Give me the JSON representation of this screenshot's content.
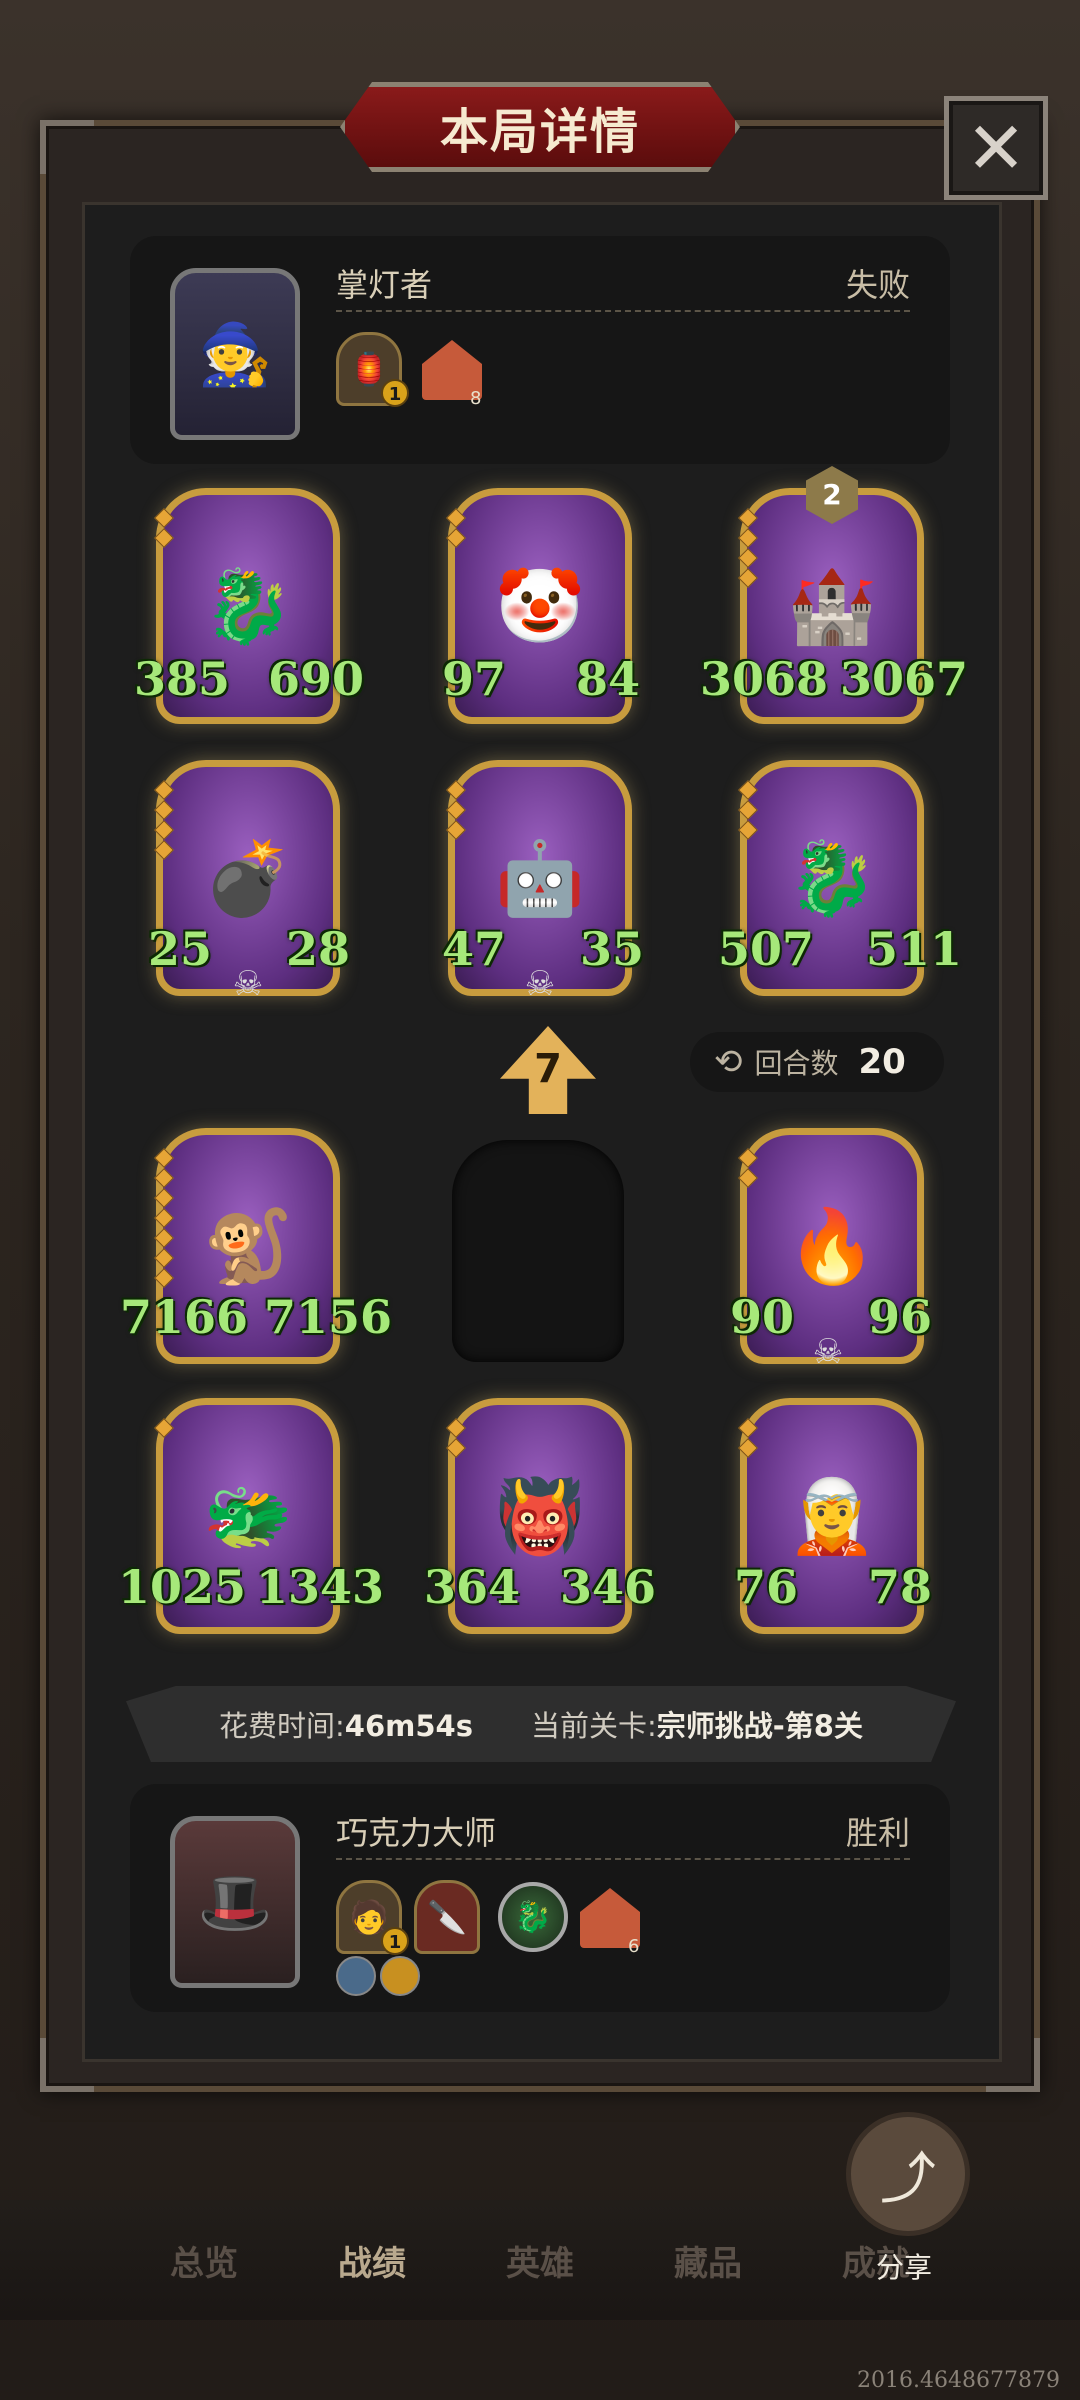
{
  "title": "本局详情",
  "close_symbol": "✕",
  "opponent": {
    "name": "掌灯者",
    "result": "失败",
    "items": [
      {
        "icon": "lantern-icon",
        "badge": "1"
      },
      {
        "icon": "house-icon",
        "count": "8"
      }
    ]
  },
  "board_top": [
    {
      "name": "dragon",
      "atk": "385",
      "hp": "690"
    },
    {
      "name": "jester",
      "atk": "97",
      "hp": "84"
    },
    {
      "name": "castle",
      "atk": "3068",
      "hp": "3067",
      "star": "2"
    },
    {
      "name": "bomber",
      "atk": "25",
      "hp": "28",
      "skull": true
    },
    {
      "name": "robot",
      "atk": "47",
      "hp": "35",
      "skull": true
    },
    {
      "name": "dragon",
      "atk": "507",
      "hp": "511"
    }
  ],
  "level": "7",
  "rounds": {
    "label": "回合数",
    "value": "20"
  },
  "board_bottom": [
    {
      "name": "monkey-king",
      "atk": "7166",
      "hp": "7156"
    },
    {
      "name": "empty"
    },
    {
      "name": "red-dragon",
      "atk": "90",
      "hp": "96",
      "skull": true
    },
    {
      "name": "blue-dragon",
      "atk": "1025",
      "hp": "1343"
    },
    {
      "name": "demon",
      "atk": "364",
      "hp": "346"
    },
    {
      "name": "elf",
      "atk": "76",
      "hp": "78"
    }
  ],
  "info": {
    "time_label": "花费时间:",
    "time_value": "46m54s",
    "stage_label": "当前关卡:",
    "stage_value": "宗师挑战-第8关"
  },
  "player": {
    "name": "巧克力大师",
    "result": "胜利",
    "items": [
      {
        "icon": "hero-icon",
        "badge": "1"
      },
      {
        "icon": "knife-icon"
      },
      {
        "icon": "jade-dragon-icon"
      },
      {
        "icon": "house-icon",
        "count": "6"
      }
    ]
  },
  "nav": {
    "items": [
      "总览",
      "战绩",
      "英雄",
      "藏品",
      "成就"
    ],
    "active": "战绩"
  },
  "share_label": "分享",
  "version": "2016.4648677879",
  "colors": {
    "stat": "#a6e87a",
    "card_border": "#c89c3e",
    "title_red": "#8a1a1a"
  }
}
